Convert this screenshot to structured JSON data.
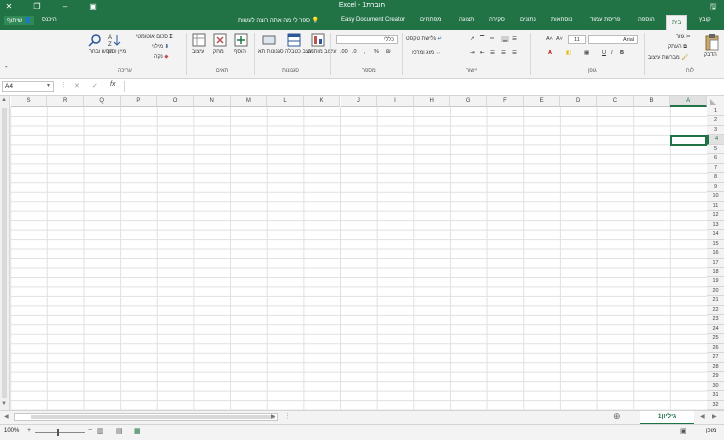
{
  "app": {
    "title": "Excel - חוברת1",
    "share_label": "שיתוף",
    "signin_label": "היכנס",
    "tell_me": "ספר לי מה אתה רוצה לעשות",
    "brand_color": "#217346"
  },
  "tabs": [
    {
      "label": "קובץ",
      "active": false
    },
    {
      "label": "בית",
      "active": true
    },
    {
      "label": "הוספה",
      "active": false
    },
    {
      "label": "פריסת עמוד",
      "active": false
    },
    {
      "label": "נוסחאות",
      "active": false
    },
    {
      "label": "נתונים",
      "active": false
    },
    {
      "label": "סקירה",
      "active": false
    },
    {
      "label": "תצוגה",
      "active": false
    },
    {
      "label": "מפתחים",
      "active": false
    },
    {
      "label": "Easy Document Creator",
      "active": false
    }
  ],
  "ribbon": {
    "clipboard": {
      "group": "לוח",
      "paste": "הדבק",
      "cut": "גזור",
      "copy": "העתק",
      "format_painter": "מברשת עיצוב"
    },
    "font": {
      "group": "גופן",
      "font_name": "Arial",
      "font_size": "11",
      "bold": "B",
      "italic": "I",
      "underline": "U"
    },
    "alignment": {
      "group": "יישור",
      "wrap_text": "גלישת טקסט",
      "merge_center": "מזג ומרכז"
    },
    "number": {
      "group": "מספר",
      "format": "כללי",
      "percent": "%",
      "comma": ","
    },
    "styles": {
      "group": "סגנונות",
      "conditional": "עיצוב מותנה",
      "format_table": "עצב כטבלה",
      "cell_styles": "סגנונות תא"
    },
    "cells": {
      "group": "תאים",
      "insert": "הוסף",
      "delete": "מחק",
      "format": "עיצוב"
    },
    "editing": {
      "group": "עריכה",
      "autosum": "סכום אוטומטי",
      "fill": "מילוי",
      "clear": "נקה",
      "sort_filter": "מיין וסנן",
      "find_select": "חפש ובחר"
    }
  },
  "formula_bar": {
    "name_box": "A4",
    "fx": "fx",
    "cancel": "✕",
    "enter": "✓",
    "value": ""
  },
  "grid": {
    "columns": [
      "A",
      "B",
      "C",
      "D",
      "E",
      "F",
      "G",
      "H",
      "I",
      "J",
      "K",
      "L",
      "M",
      "N",
      "O",
      "P",
      "Q",
      "R",
      "S"
    ],
    "rows": [
      "1",
      "2",
      "3",
      "4",
      "5",
      "6",
      "7",
      "8",
      "9",
      "10",
      "11",
      "12",
      "13",
      "14",
      "15",
      "16",
      "17",
      "18",
      "19",
      "20",
      "21",
      "22",
      "23",
      "24",
      "25",
      "26",
      "27",
      "28",
      "29",
      "30",
      "31",
      "32"
    ],
    "active_cell": "A4"
  },
  "sheets": [
    {
      "name": "גיליון1",
      "active": true
    }
  ],
  "status": {
    "ready": "מוכן",
    "zoom": "100%"
  }
}
